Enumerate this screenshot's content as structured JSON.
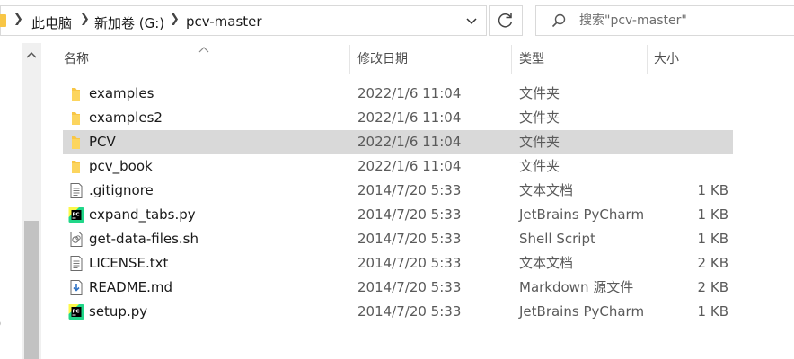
{
  "breadcrumb": {
    "items": [
      "此电脑",
      "新加卷 (G:)",
      "pcv-master"
    ]
  },
  "search": {
    "placeholder": "搜索\"pcv-master\""
  },
  "left_nav": {
    "partial_text": ")"
  },
  "columns": {
    "name": "名称",
    "date": "修改日期",
    "type": "类型",
    "size": "大小"
  },
  "files": [
    {
      "name": "examples",
      "date": "2022/1/6 11:04",
      "type": "文件夹",
      "size": "",
      "icon": "folder-icon"
    },
    {
      "name": "examples2",
      "date": "2022/1/6 11:04",
      "type": "文件夹",
      "size": "",
      "icon": "folder-icon"
    },
    {
      "name": "PCV",
      "date": "2022/1/6 11:04",
      "type": "文件夹",
      "size": "",
      "icon": "folder-icon",
      "selected": true
    },
    {
      "name": "pcv_book",
      "date": "2022/1/6 11:04",
      "type": "文件夹",
      "size": "",
      "icon": "folder-icon"
    },
    {
      "name": ".gitignore",
      "date": "2014/7/20 5:33",
      "type": "文本文档",
      "size": "1 KB",
      "icon": "text-file-icon"
    },
    {
      "name": "expand_tabs.py",
      "date": "2014/7/20 5:33",
      "type": "JetBrains PyCharm",
      "size": "1 KB",
      "icon": "pycharm-file-icon"
    },
    {
      "name": "get-data-files.sh",
      "date": "2014/7/20 5:33",
      "type": "Shell Script",
      "size": "1 KB",
      "icon": "shell-script-icon"
    },
    {
      "name": "LICENSE.txt",
      "date": "2014/7/20 5:33",
      "type": "文本文档",
      "size": "2 KB",
      "icon": "text-file-icon"
    },
    {
      "name": "README.md",
      "date": "2014/7/20 5:33",
      "type": "Markdown 源文件",
      "size": "2 KB",
      "icon": "markdown-file-icon"
    },
    {
      "name": "setup.py",
      "date": "2014/7/20 5:33",
      "type": "JetBrains PyCharm",
      "size": "1 KB",
      "icon": "pycharm-file-icon"
    }
  ],
  "colors": {
    "folder": "#f8c646",
    "selection": "#d9d9d9",
    "border": "#d9d9d9",
    "scrollbar_thumb": "#c2c2c2"
  }
}
